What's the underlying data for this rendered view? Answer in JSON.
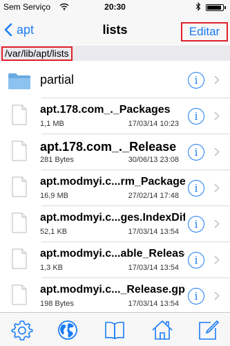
{
  "status_bar": {
    "carrier": "Sem Serviço",
    "time": "20:30",
    "battery_level": 0.9
  },
  "nav": {
    "back_label": "apt",
    "title": "lists",
    "edit_label": "Editar"
  },
  "path": "/var/lib/apt/lists",
  "rows": [
    {
      "name": "partial",
      "type": "folder",
      "size": "",
      "date": ""
    },
    {
      "name": "apt.178.com_._Packages",
      "type": "file",
      "size": "1,1 MB",
      "date": "17/03/14 10:23"
    },
    {
      "name": "apt.178.com_._Release",
      "type": "file",
      "size": "281 Bytes",
      "date": "30/06/13 23:08"
    },
    {
      "name": "apt.modmyi.c...rm_Packages",
      "type": "file",
      "size": "16,9 MB",
      "date": "27/02/14 17:48"
    },
    {
      "name": "apt.modmyi.c...ges.IndexDiff",
      "type": "file",
      "size": "52,1 KB",
      "date": "17/03/14 13:54"
    },
    {
      "name": "apt.modmyi.c...able_Release",
      "type": "file",
      "size": "1,3 KB",
      "date": "17/03/14 13:54"
    },
    {
      "name": "apt.modmyi.c..._Release.gpg",
      "type": "file",
      "size": "198 Bytes",
      "date": "17/03/14 13:54"
    }
  ],
  "info_glyph": "i",
  "tabs": [
    "gear-icon",
    "globe-icon",
    "book-icon",
    "home-icon",
    "edit-icon"
  ],
  "colors": {
    "accent": "#1a7cf5",
    "highlight": "#e0202a"
  }
}
